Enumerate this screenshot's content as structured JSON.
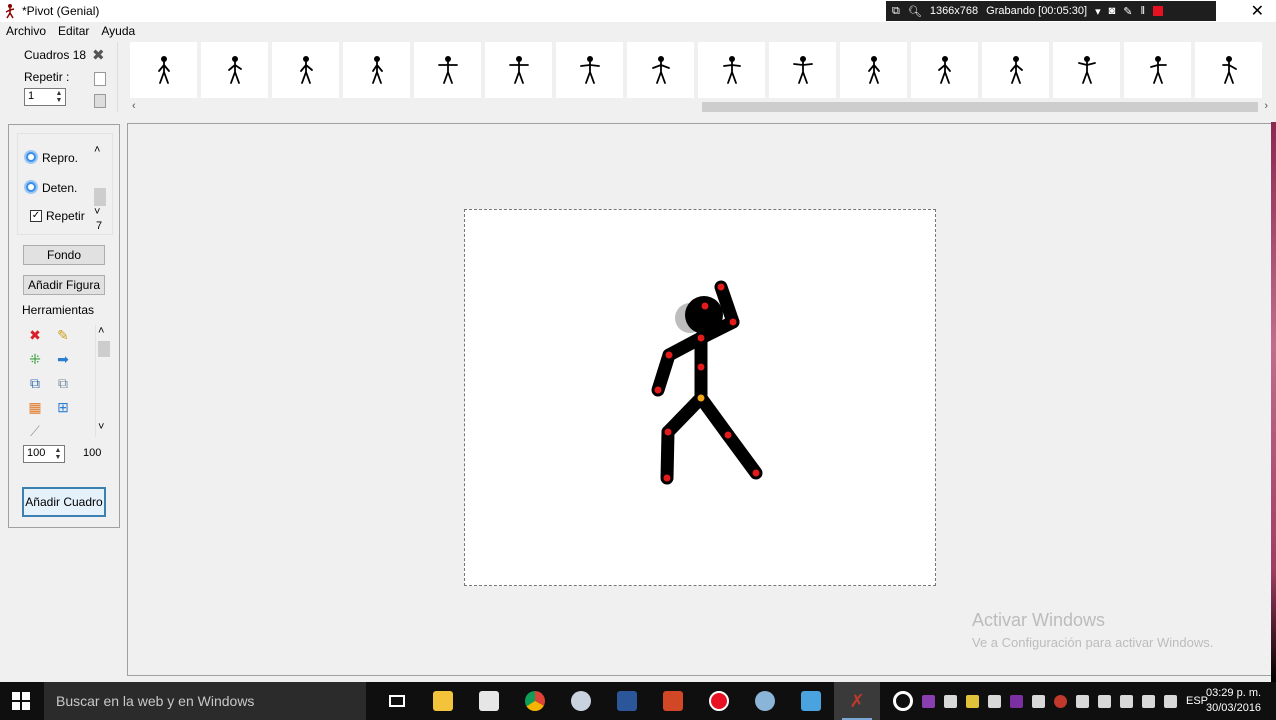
{
  "window": {
    "title": "*Pivot (Genial)",
    "close_glyph": "✕"
  },
  "recorder": {
    "resolution": "1366x768",
    "status": "Grabando [00:05:30]"
  },
  "menu": [
    "Archivo",
    "Editar",
    "Ayuda"
  ],
  "frames": {
    "label": "Cuadros 18",
    "repeat_label": "Repetir :",
    "repeat_value": "1",
    "count": 16
  },
  "playback": {
    "play_label": "Repro.",
    "stop_label": "Deten.",
    "loop_label": "Repetir",
    "loop_checked": true,
    "speed_value": "7"
  },
  "buttons": {
    "background": "Fondo",
    "add_figure": "Añadir Figura",
    "add_frame": "Añadir Cuadro"
  },
  "tools": {
    "label": "Herramientas",
    "scale_value": "100",
    "scale_readout": "100"
  },
  "watermark": {
    "title": "Activar Windows",
    "subtitle": "Ve a Configuración para activar Windows."
  },
  "taskbar": {
    "search_placeholder": "Buscar en la web y en Windows",
    "language": "ESP",
    "time": "03:29 p. m.",
    "date": "30/03/2016"
  },
  "colors": {
    "joint": "#e41b1b",
    "center_joint": "#f2a516",
    "accent": "#3c7fb1"
  }
}
